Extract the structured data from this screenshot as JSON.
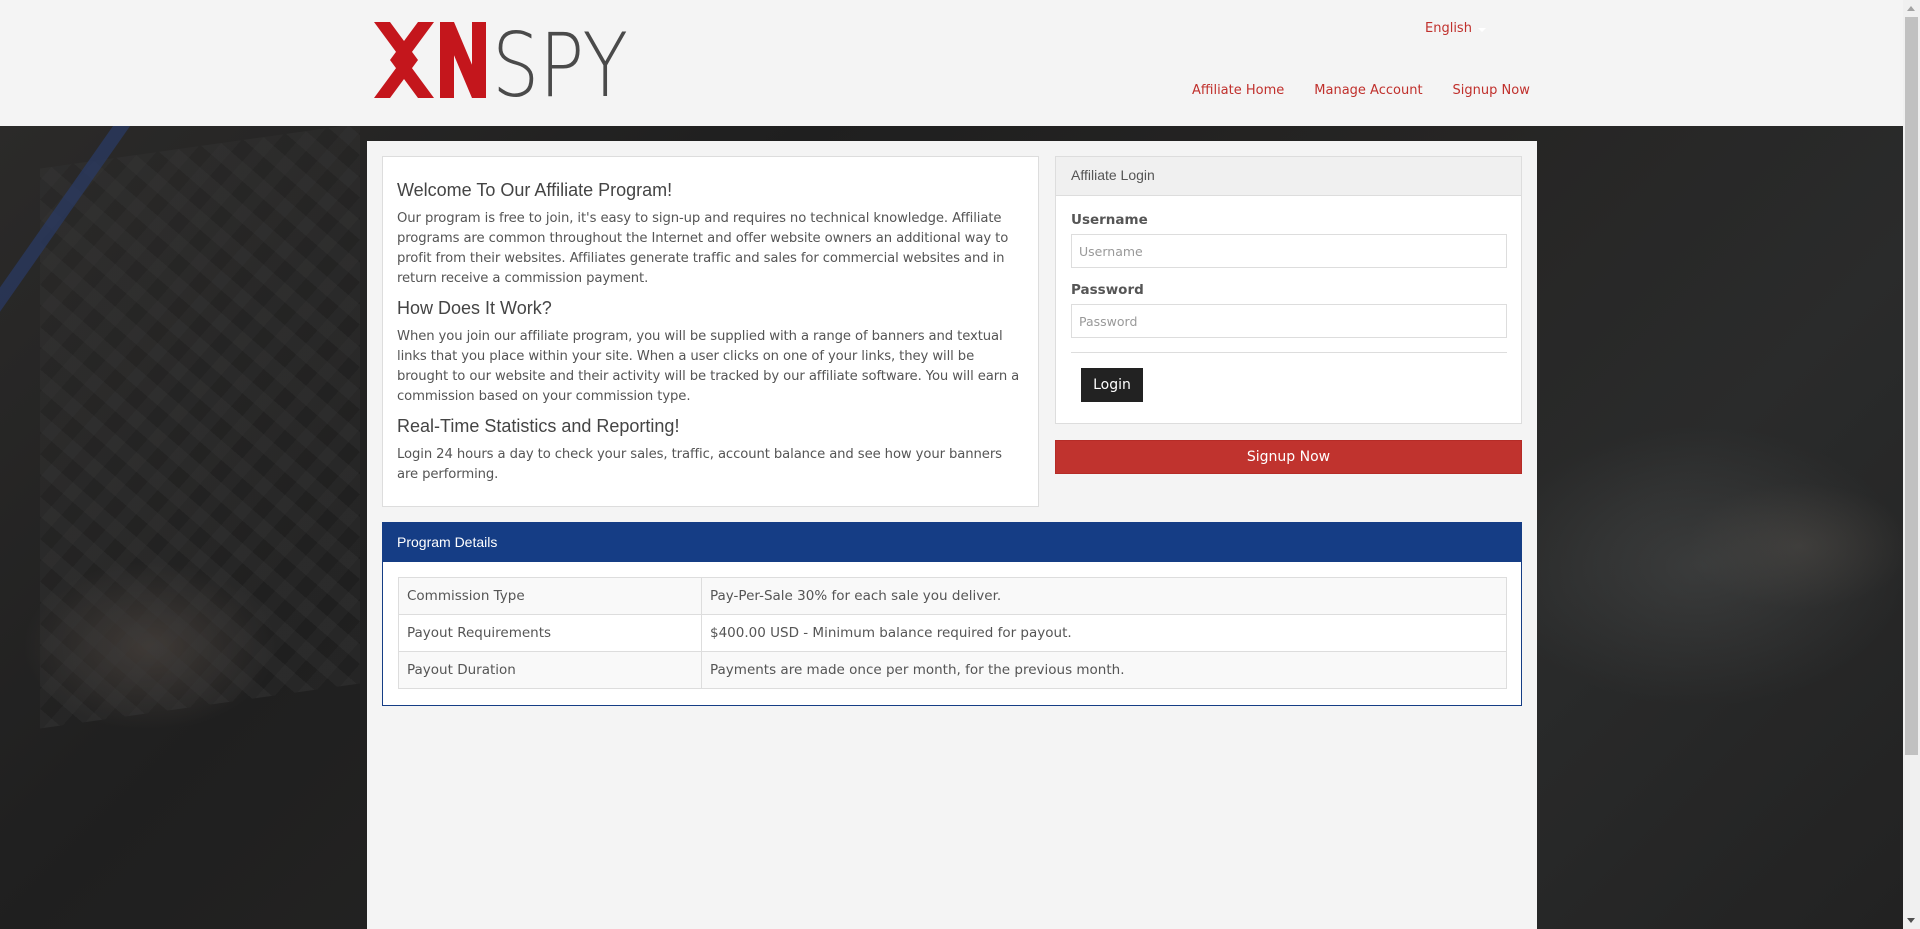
{
  "header": {
    "logo": {
      "part1": "XN",
      "part2": "SPY",
      "accent": "#c4161c",
      "secondary": "#4a4a4a"
    },
    "language": {
      "selected": "English",
      "icon": "caret-down-icon"
    },
    "nav": [
      {
        "label": "Affiliate Home"
      },
      {
        "label": "Manage Account"
      },
      {
        "label": "Signup Now"
      }
    ],
    "link_color": "#c0302c"
  },
  "welcome": {
    "sections": [
      {
        "heading": "Welcome To Our Affiliate Program!",
        "body": "Our program is free to join, it's easy to sign-up and requires no technical knowledge. Affiliate programs are common throughout the Internet and offer website owners an additional way to profit from their websites. Affiliates generate traffic and sales for commercial websites and in return receive a commission payment."
      },
      {
        "heading": "How Does It Work?",
        "body": "When you join our affiliate program, you will be supplied with a range of banners and textual links that you place within your site. When a user clicks on one of your links, they will be brought to our website and their activity will be tracked by our affiliate software. You will earn a commission based on your commission type."
      },
      {
        "heading": "Real-Time Statistics and Reporting!",
        "body": "Login 24 hours a day to check your sales, traffic, account balance and see how your banners are performing."
      }
    ]
  },
  "login": {
    "title": "Affiliate Login",
    "username_label": "Username",
    "username_placeholder": "Username",
    "username_value": "",
    "password_label": "Password",
    "password_placeholder": "Password",
    "password_value": "",
    "login_button": "Login",
    "signup_button": "Signup Now"
  },
  "program": {
    "title": "Program Details",
    "header_color": "#153d85",
    "rows": [
      {
        "label": "Commission Type",
        "value": "Pay-Per-Sale 30% for each sale you deliver."
      },
      {
        "label": "Payout Requirements",
        "value": "$400.00 USD - Minimum balance required for payout."
      },
      {
        "label": "Payout Duration",
        "value": "Payments are made once per month, for the previous month."
      }
    ]
  }
}
